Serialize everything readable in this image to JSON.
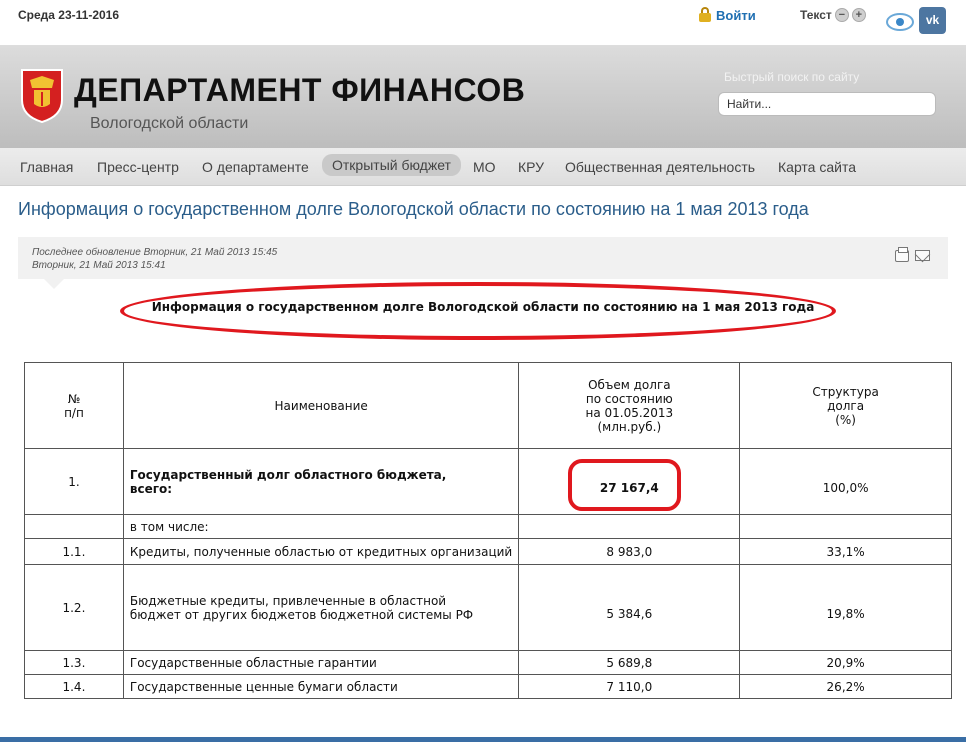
{
  "topbar": {
    "date": "Среда 23-11-2016",
    "login_label": "Войти",
    "text_size_label": "Текст",
    "decrease_symbol": "−",
    "increase_symbol": "+",
    "social_vk": "vk"
  },
  "header": {
    "site_title": "ДЕПАРТАМЕНТ ФИНАНСОВ",
    "site_subtitle": "Вологодской области",
    "search_label": "Быстрый поиск по сайту",
    "search_value": "Найти..."
  },
  "nav": {
    "items": [
      {
        "label": "Главная"
      },
      {
        "label": "Пресс-центр"
      },
      {
        "label": "О департаменте"
      },
      {
        "label": "Открытый бюджет"
      },
      {
        "label": "МО"
      },
      {
        "label": "КРУ"
      },
      {
        "label": "Общественная деятельность"
      },
      {
        "label": "Карта сайта"
      }
    ],
    "active_index": 3
  },
  "article": {
    "heading": "Информация о государственном долге Вологодской области по состоянию на 1 мая 2013 года",
    "last_updated": "Последнее обновление Вторник, 21 Май 2013 15:45",
    "created": "Вторник, 21 Май 2013 15:41",
    "doc_title": "Информация о государственном долге Вологодской области по состоянию на 1 мая 2013 года"
  },
  "table": {
    "headers": {
      "num": "№\nп/п",
      "name": "Наименование",
      "volume": "Объем долга\nпо состоянию\nна 01.05.2013\n(млн.руб.)",
      "structure": "Структура\nдолга\n(%)"
    },
    "rows": [
      {
        "num": "1.",
        "name": "Государственный долг областного бюджета,\nвсего:",
        "volume": "27 167,4",
        "structure": "100,0%"
      },
      {
        "num": "",
        "name": "в том числе:",
        "volume": "",
        "structure": ""
      },
      {
        "num": "1.1.",
        "name": "Кредиты, полученные областью от кредитных организаций",
        "volume": "8 983,0",
        "structure": "33,1%"
      },
      {
        "num": "1.2.",
        "name": "Бюджетные кредиты, привлеченные в областной\nбюджет от других бюджетов бюджетной системы РФ",
        "volume": "5 384,6",
        "structure": "19,8%"
      },
      {
        "num": "1.3.",
        "name": "Государственные областные гарантии",
        "volume": "5 689,8",
        "structure": "20,9%"
      },
      {
        "num": "1.4.",
        "name": "Государственные ценные бумаги области",
        "volume": "7 110,0",
        "structure": "26,2%"
      }
    ]
  },
  "colors": {
    "accent_link": "#1f6fb2",
    "heading_blue": "#2a5d8a",
    "highlight_red": "#e0181e",
    "crest_red": "#d42020"
  }
}
